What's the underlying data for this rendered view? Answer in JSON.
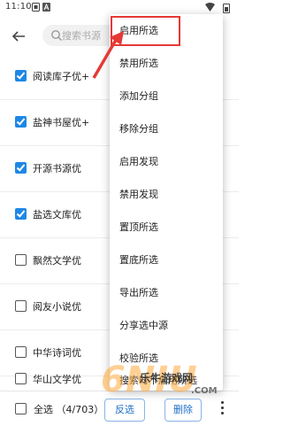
{
  "status_bar": {
    "time": "11:10"
  },
  "toolbar": {
    "search_placeholder": "搜索书源"
  },
  "sources": [
    {
      "label": "阅读库子优+",
      "checked": true
    },
    {
      "label": "盐神书屋优+",
      "checked": true
    },
    {
      "label": "开源书源优",
      "checked": true
    },
    {
      "label": "盐选文库优",
      "checked": true
    },
    {
      "label": "飘然文学优",
      "checked": false
    },
    {
      "label": "阅友小说优",
      "checked": false
    },
    {
      "label": "中华诗词优",
      "checked": false
    },
    {
      "label": "华山文学优",
      "checked": false
    }
  ],
  "bottom_bar": {
    "select_all_label": "全选 （4/703）",
    "invert_label": "反选",
    "delete_label": "删除"
  },
  "menu": {
    "items": [
      "启用所选",
      "禁用所选",
      "添加分组",
      "移除分组",
      "启用发现",
      "禁用发现",
      "置顶所选",
      "置底所选",
      "导出所选",
      "分享选中源",
      "校验所选",
      "搜索时不启用所选"
    ],
    "highlighted_index": 0
  },
  "watermark": {
    "logo_text": "6NIU",
    "site_text": "乐牛游戏网",
    "domain_text": ".COM"
  },
  "colors": {
    "checkbox_checked": "#1e88e5",
    "highlight": "#e53935",
    "button_text": "#1e6fc8"
  }
}
